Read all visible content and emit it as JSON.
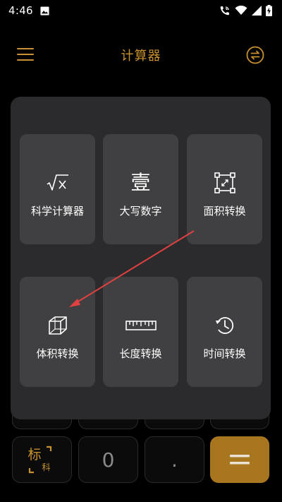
{
  "status_bar": {
    "time": "4:46",
    "icons": [
      "image-icon",
      "wifi-calling-icon",
      "wifi-icon",
      "signal-icon",
      "battery-charging-icon"
    ]
  },
  "header": {
    "title": "计算器",
    "menu_icon": "menu-icon",
    "swap_icon": "swap-icon"
  },
  "popup": {
    "tiles": [
      {
        "label": "科学计算器",
        "icon": "sqrt-x-icon"
      },
      {
        "label": "大写数字",
        "icon": "uppercase-number-icon",
        "glyph": "壹"
      },
      {
        "label": "面积转换",
        "icon": "area-icon"
      },
      {
        "label": "体积转换",
        "icon": "cube-icon"
      },
      {
        "label": "长度转换",
        "icon": "ruler-icon"
      },
      {
        "label": "时间转换",
        "icon": "clock-history-icon"
      }
    ]
  },
  "keypad": {
    "mode_main": "标",
    "mode_sub": "科",
    "zero": "0",
    "dot": ".",
    "equal_icon": "equals-icon"
  },
  "colors": {
    "accent": "#c89130",
    "equal_key": "#a8761f",
    "popup_bg": "#2b2b2d",
    "tile_bg": "#404042",
    "annotation_arrow": "#e04040"
  }
}
